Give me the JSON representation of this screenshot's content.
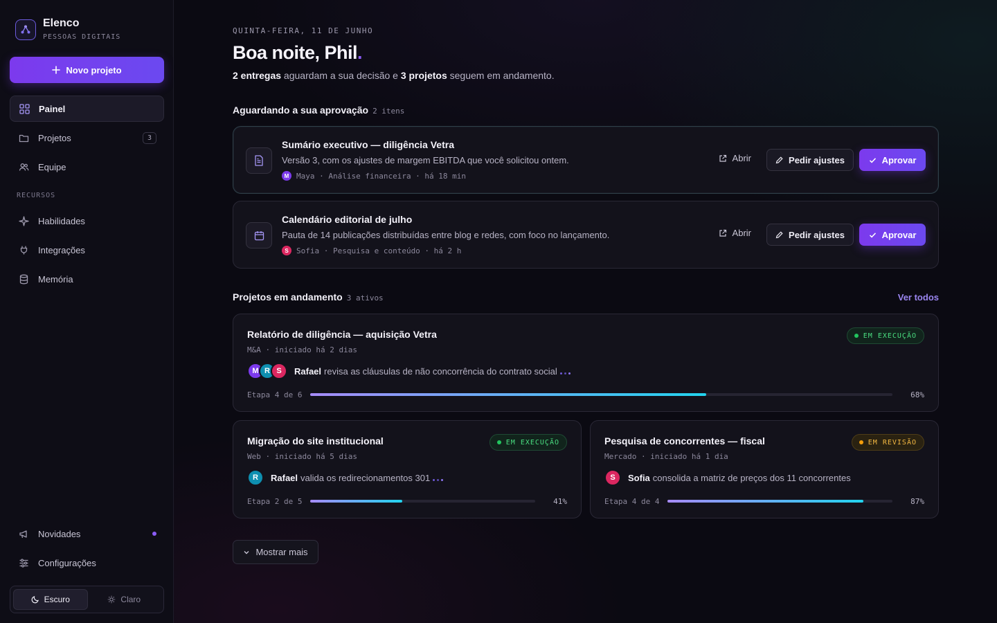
{
  "brand": {
    "name": "Elenco",
    "subtitle": "PESSOAS DIGITAIS"
  },
  "sidebar": {
    "new_project": "Novo projeto",
    "items": [
      {
        "label": "Painel",
        "icon": "grid-icon"
      },
      {
        "label": "Projetos",
        "icon": "folder-icon",
        "count": "3"
      },
      {
        "label": "Equipe",
        "icon": "users-icon"
      }
    ],
    "section_label": "RECURSOS",
    "resources": [
      {
        "label": "Habilidades",
        "icon": "sparkle-icon"
      },
      {
        "label": "Integrações",
        "icon": "plug-icon"
      },
      {
        "label": "Memória",
        "icon": "database-icon"
      }
    ],
    "bottom": [
      {
        "label": "Novidades",
        "icon": "megaphone-icon"
      },
      {
        "label": "Configurações",
        "icon": "sliders-icon"
      }
    ],
    "theme": {
      "dark": "Escuro",
      "light": "Claro"
    }
  },
  "header": {
    "date": "QUINTA-FEIRA, 11 DE JUNHO",
    "greeting": "Boa noite, Phil",
    "greeting_dot": ".",
    "summary_a": "2 entregas",
    "summary_b": " aguardam a sua decisão e ",
    "summary_c": "3 projetos",
    "summary_d": " seguem em andamento."
  },
  "approvals": {
    "title": "Aguardando a sua aprovação",
    "count": "2 itens",
    "open_label": "Abrir",
    "adjust_label": "Pedir ajustes",
    "approve_label": "Aprovar",
    "items": [
      {
        "title": "Sumário executivo — diligência Vetra",
        "desc": "Versão 3, com os ajustes de margem EBITDA que você solicitou ontem.",
        "initial": "M",
        "meta": "Maya · Análise financeira · há 18 min",
        "color": "#7c3aed"
      },
      {
        "title": "Calendário editorial de julho",
        "desc": "Pauta de 14 publicações distribuídas entre blog e redes, com foco no lançamento.",
        "initial": "S",
        "meta": "Sofia · Pesquisa e conteúdo · há 2 h",
        "color": "#db2760"
      }
    ]
  },
  "projects": {
    "title": "Projetos em andamento",
    "count": "3 ativos",
    "see_all": "Ver todos",
    "items": [
      {
        "title": "Relatório de diligência — aquisição Vetra",
        "meta": "M&A · iniciado há 2 dias",
        "status": "EM EXECUÇÃO",
        "agent": "Rafael",
        "activity": "revisa as cláusulas de não concorrência do contrato social",
        "stage": "Etapa 4 de 6",
        "progress": 68,
        "progress_label": "68%",
        "avatars": [
          "M",
          "R",
          "S"
        ]
      },
      {
        "title": "Migração do site institucional",
        "meta": "Web · iniciado há 5 dias",
        "status": "EM EXECUÇÃO",
        "agent": "Rafael",
        "activity": "valida os redirecionamentos 301",
        "stage": "Etapa 2 de 5",
        "progress": 41,
        "progress_label": "41%",
        "avatars": [
          "R"
        ]
      },
      {
        "title": "Pesquisa de concorrentes — fiscal",
        "meta": "Mercado · iniciado há 1 dia",
        "status": "EM REVISÃO",
        "agent": "Sofia",
        "activity": "consolida a matriz de preços dos 11 concorrentes",
        "stage": "Etapa 4 de 4",
        "progress": 87,
        "progress_label": "87%",
        "avatars": [
          "S"
        ]
      }
    ],
    "show_more": "Mostrar mais"
  },
  "colors": {
    "accent": "#7c3aed",
    "rafael": "#0e8fb0",
    "sofia": "#db2760",
    "maya": "#7c3aed",
    "running": "#22c55e",
    "review": "#f59e0b"
  }
}
